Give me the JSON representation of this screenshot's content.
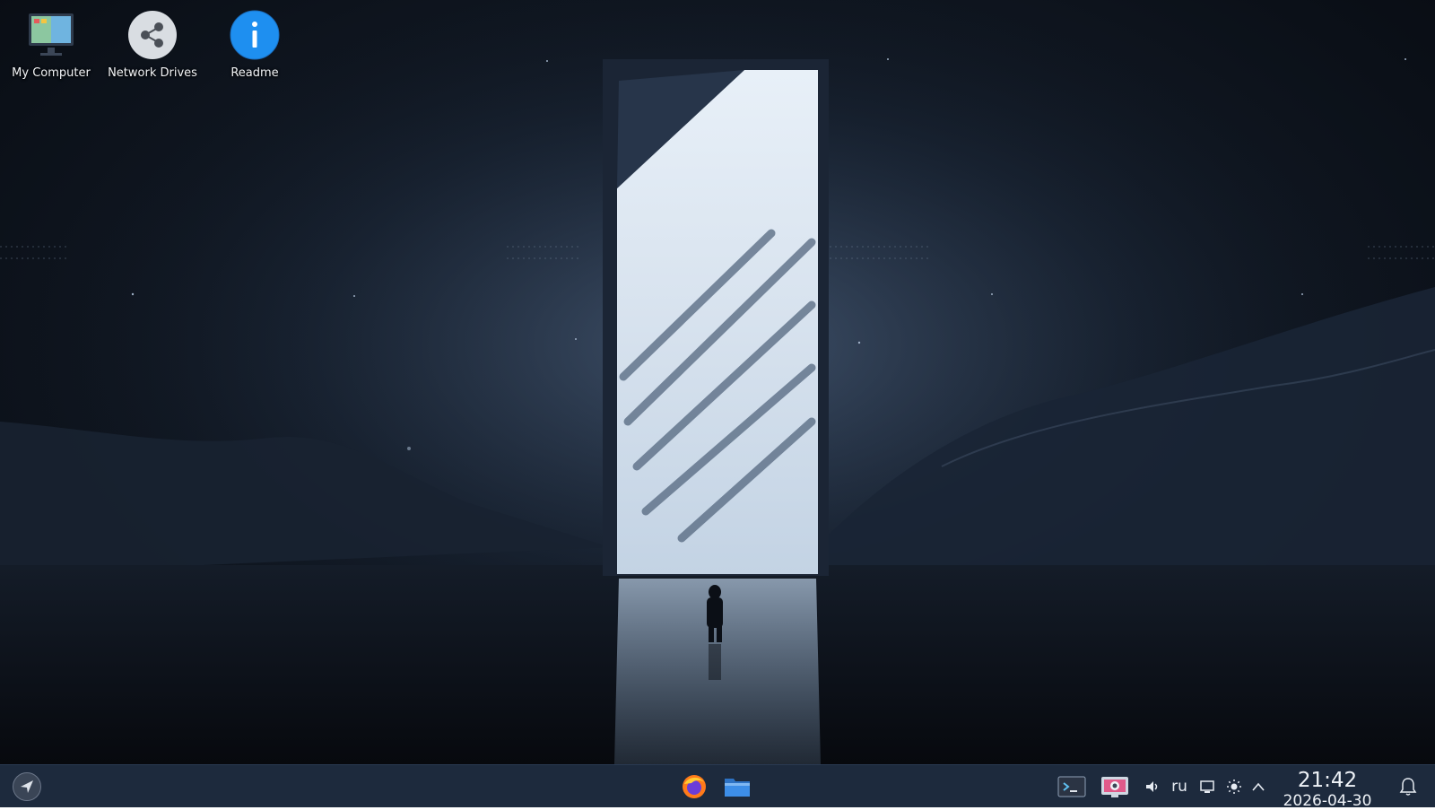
{
  "desktop": {
    "icons": [
      {
        "label": "My Computer",
        "icon": "computer-icon"
      },
      {
        "label": "Network Drives",
        "icon": "network-share-icon"
      },
      {
        "label": "Readme",
        "icon": "info-icon"
      }
    ]
  },
  "taskbar": {
    "launcher_icon": "app-launcher-icon",
    "apps": [
      {
        "icon": "firefox-icon"
      },
      {
        "icon": "file-manager-icon"
      }
    ],
    "tray": {
      "terminal_icon": "terminal-icon",
      "screenshot_icon": "screenshot-icon",
      "volume_icon": "volume-icon",
      "keyboard_layout": "ru",
      "display_icon": "display-icon",
      "brightness_icon": "brightness-icon",
      "expand_icon": "chevron-up-icon",
      "notifications_icon": "bell-icon"
    },
    "clock": {
      "time": "21:42",
      "date": "2026-04-30"
    }
  },
  "colors": {
    "taskbar_bg": "#1d2a3d",
    "readme_blue": "#1e8ff0",
    "firefox_orange": "#ff7a1a",
    "folder_blue": "#3d8ee8"
  }
}
